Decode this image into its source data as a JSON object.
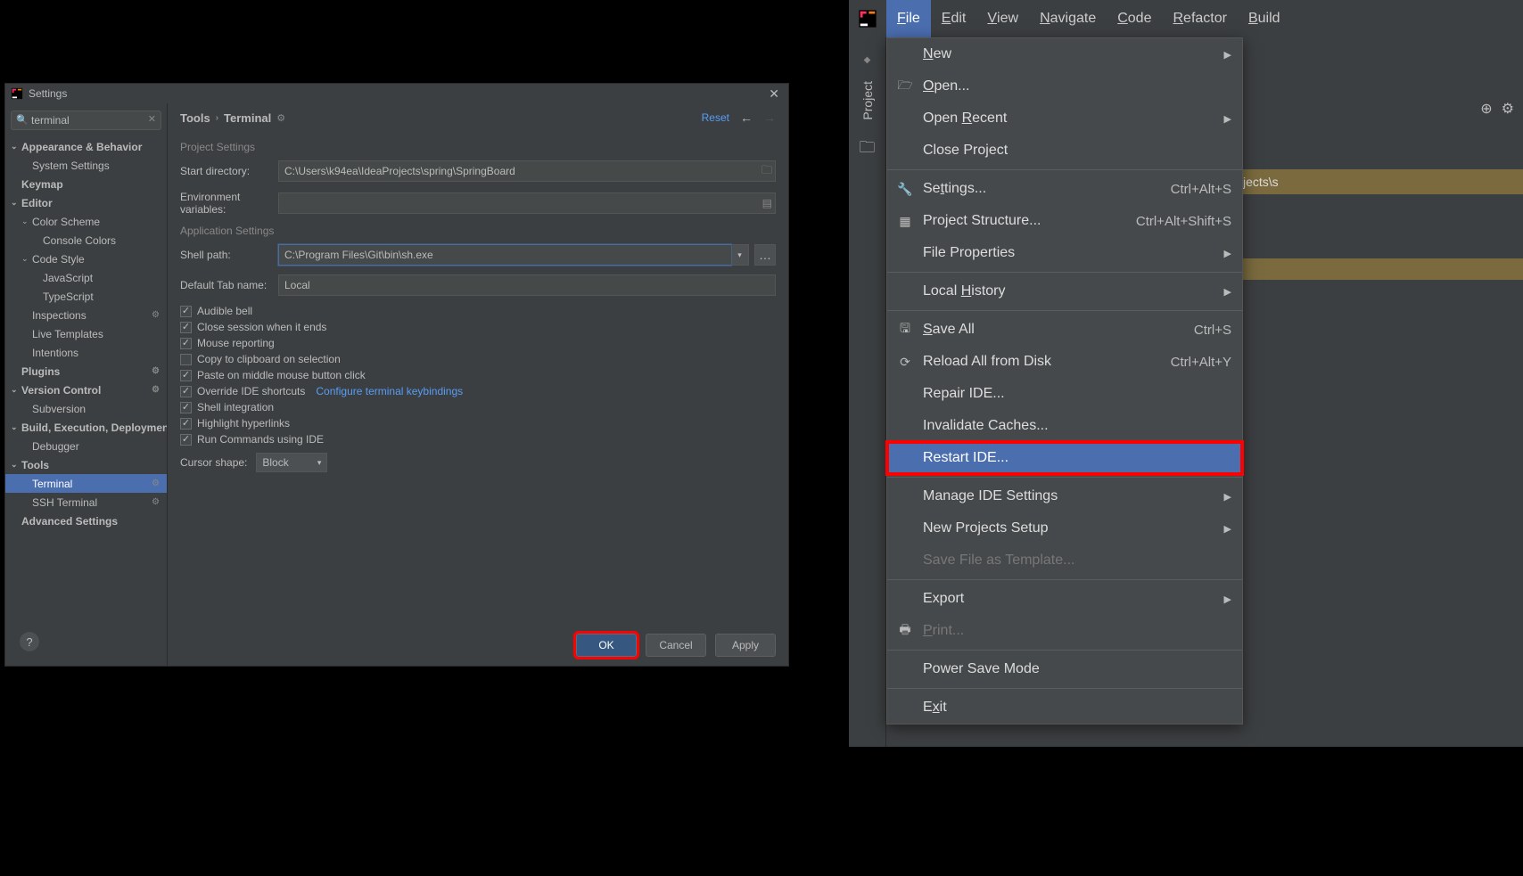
{
  "dialog": {
    "title": "Settings",
    "search": {
      "value": "terminal"
    },
    "tree": {
      "appearance": "Appearance & Behavior",
      "system_settings": "System Settings",
      "keymap": "Keymap",
      "editor": "Editor",
      "color_scheme": "Color Scheme",
      "console_colors": "Console Colors",
      "code_style": "Code Style",
      "javascript": "JavaScript",
      "typescript": "TypeScript",
      "inspections": "Inspections",
      "live_templates": "Live Templates",
      "intentions": "Intentions",
      "plugins": "Plugins",
      "version_control": "Version Control",
      "subversion": "Subversion",
      "build": "Build, Execution, Deployment",
      "debugger": "Debugger",
      "tools": "Tools",
      "terminal": "Terminal",
      "ssh_terminal": "SSH Terminal",
      "advanced": "Advanced Settings"
    },
    "breadcrumb": {
      "a": "Tools",
      "b": "Terminal"
    },
    "reset": "Reset",
    "section1": "Project Settings",
    "start_dir_label": "Start directory:",
    "start_dir_value": "C:\\Users\\k94ea\\IdeaProjects\\spring\\SpringBoard",
    "env_label": "Environment variables:",
    "section2": "Application Settings",
    "shell_label": "Shell path:",
    "shell_value": "C:\\Program Files\\Git\\bin\\sh.exe",
    "tab_label": "Default Tab name:",
    "tab_value": "Local",
    "chk_audible": "Audible bell",
    "chk_close": "Close session when it ends",
    "chk_mouse": "Mouse reporting",
    "chk_copy": "Copy to clipboard on selection",
    "chk_paste": "Paste on middle mouse button click",
    "chk_override": "Override IDE shortcuts",
    "link_configure": "Configure terminal keybindings",
    "chk_shell_int": "Shell integration",
    "chk_highlight": "Highlight hyperlinks",
    "chk_run": "Run Commands using IDE",
    "cursor_label": "Cursor shape:",
    "cursor_value": "Block",
    "btn_ok": "OK",
    "btn_cancel": "Cancel",
    "btn_apply": "Apply"
  },
  "ide": {
    "menubar": {
      "file": "File",
      "edit": "Edit",
      "view": "View",
      "navigate": "Navigate",
      "code": "Code",
      "refactor": "Refactor",
      "build": "Build"
    },
    "project_label": "Project",
    "path_fragment": "jects\\s",
    "dropdown": {
      "new": "New",
      "open": "Open...",
      "open_recent": "Open Recent",
      "close_project": "Close Project",
      "settings": "Settings...",
      "settings_sc": "Ctrl+Alt+S",
      "proj_struct": "Project Structure...",
      "proj_struct_sc": "Ctrl+Alt+Shift+S",
      "file_props": "File Properties",
      "local_hist": "Local History",
      "save_all": "Save All",
      "save_all_sc": "Ctrl+S",
      "reload": "Reload All from Disk",
      "reload_sc": "Ctrl+Alt+Y",
      "repair": "Repair IDE...",
      "invalidate": "Invalidate Caches...",
      "restart": "Restart IDE...",
      "manage": "Manage IDE Settings",
      "new_proj": "New Projects Setup",
      "save_tmpl": "Save File as Template...",
      "export": "Export",
      "print": "Print...",
      "power": "Power Save Mode",
      "exit": "Exit"
    }
  }
}
